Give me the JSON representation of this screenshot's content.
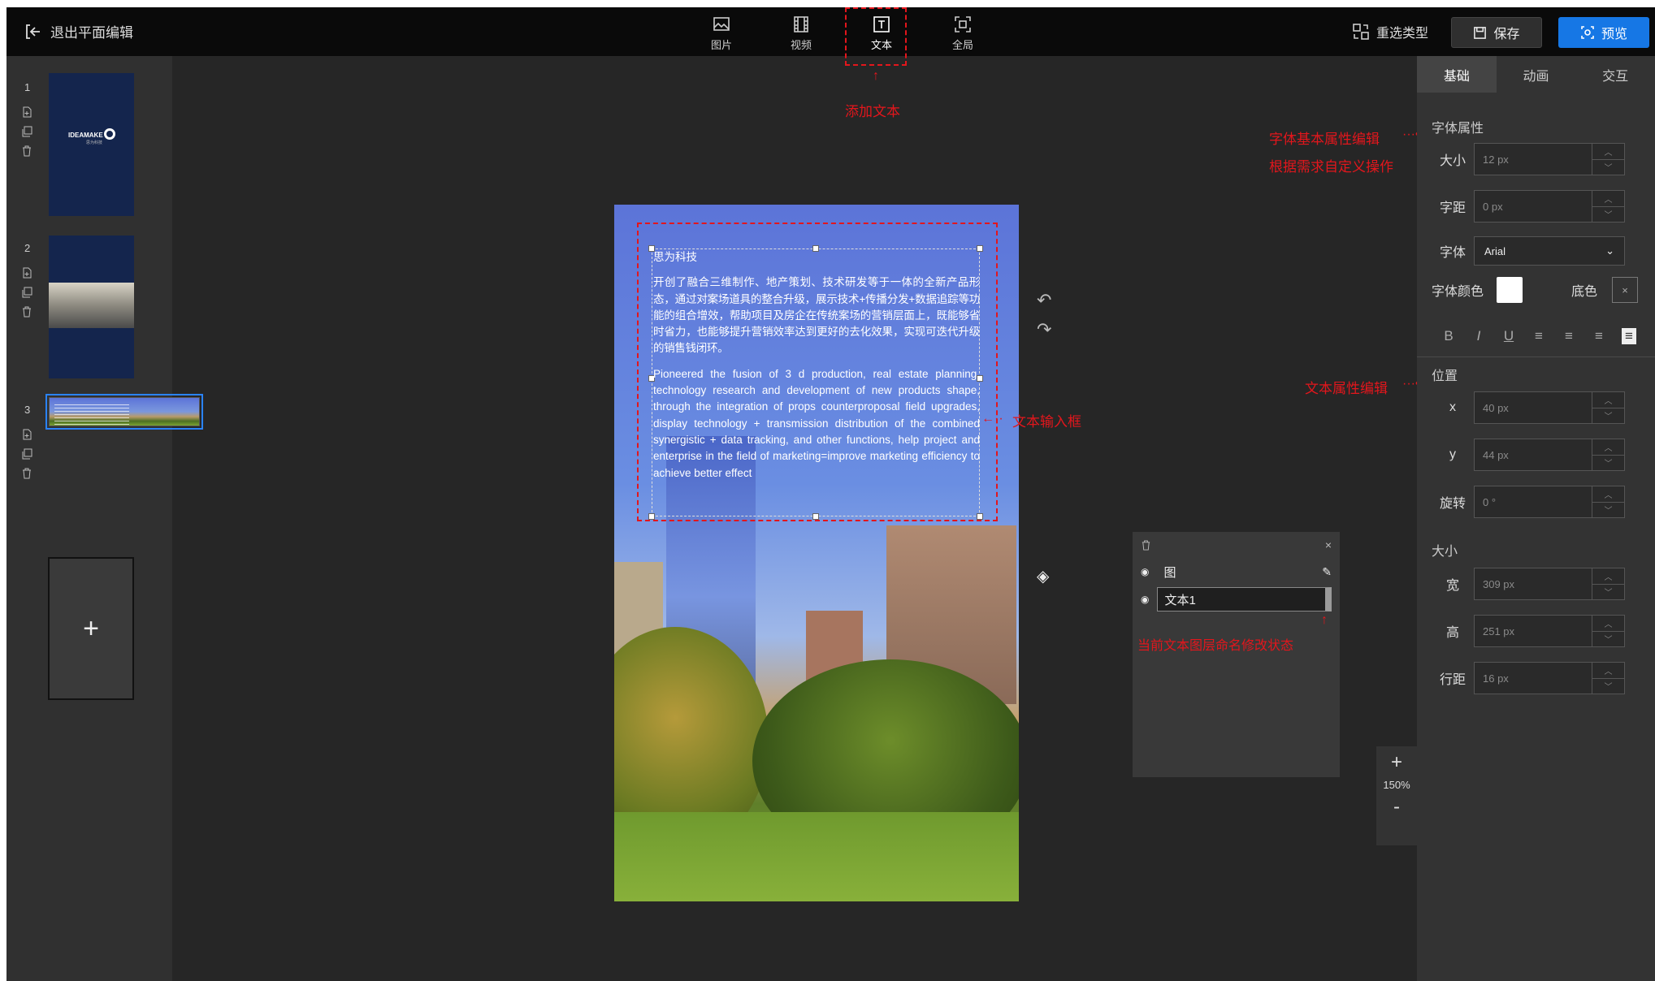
{
  "topbar": {
    "exit_label": "退出平面编辑",
    "tools": [
      {
        "label": "图片",
        "icon": "image-icon"
      },
      {
        "label": "视频",
        "icon": "video-icon"
      },
      {
        "label": "文本",
        "icon": "text-icon"
      },
      {
        "label": "全局",
        "icon": "fullscreen-icon"
      }
    ],
    "reselect_type": "重选类型",
    "save": "保存",
    "preview": "预览"
  },
  "pages": {
    "numbers": [
      "1",
      "2",
      "3"
    ],
    "thumb1_brand": "IDEAMAKE",
    "thumb1_sub": "思为科技",
    "add": "+"
  },
  "canvas_text": {
    "title": "思为科技",
    "cn_body": "开创了融合三维制作、地产策划、技术研发等于一体的全新产品形态，通过对案场道具的整合升级，展示技术+传播分发+数据追踪等功能的组合增效，帮助项目及房企在传统案场的营销层面上，既能够省时省力，也能够提升营销效率达到更好的去化效果，实现可迭代升级的销售钱闭环。",
    "en_body": "Pioneered the fusion of 3 d production, real estate planning, technology research and development of new products shape, through the integration of props counterproposal field upgrades, display technology + transmission distribution of the combined synergistic + data tracking, and other functions, help project and enterprise in the field of marketing=improve marketing efficiency to achieve better effect"
  },
  "annotations": {
    "add_text": "添加文本",
    "font_basic": "字体基本属性编辑",
    "custom": "根据需求自定义操作",
    "text_prop": "文本属性编辑",
    "text_input": "文本输入框",
    "layer_rename": "当前文本图层命名修改状态"
  },
  "layers": {
    "items": [
      {
        "name": "图",
        "icon": "eye-icon"
      },
      {
        "name": "文本1",
        "icon": "eye-icon"
      }
    ]
  },
  "zoom": {
    "plus": "+",
    "value": "150%",
    "minus": "-"
  },
  "props": {
    "tabs": [
      "基础",
      "动画",
      "交互"
    ],
    "font_section": "字体属性",
    "size_label": "大小",
    "size_value": "12 px",
    "spacing_label": "字距",
    "spacing_value": "0 px",
    "font_label": "字体",
    "font_value": "Arial",
    "color_label": "字体颜色",
    "bg_label": "底色",
    "bg_clear": "×",
    "format": [
      "B",
      "I",
      "U",
      "≡",
      "≡",
      "≡",
      "≡"
    ],
    "position_section": "位置",
    "x_label": "x",
    "x_value": "40 px",
    "y_label": "y",
    "y_value": "44 px",
    "rotate_label": "旋转",
    "rotate_value": "0 °",
    "size_section": "大小",
    "w_label": "宽",
    "w_value": "309 px",
    "h_label": "高",
    "h_value": "251 px",
    "lh_label": "行距",
    "lh_value": "16 px"
  },
  "colors": {
    "accent": "#1677e5",
    "annotation": "#e3161c",
    "text_color": "#ffffff"
  }
}
